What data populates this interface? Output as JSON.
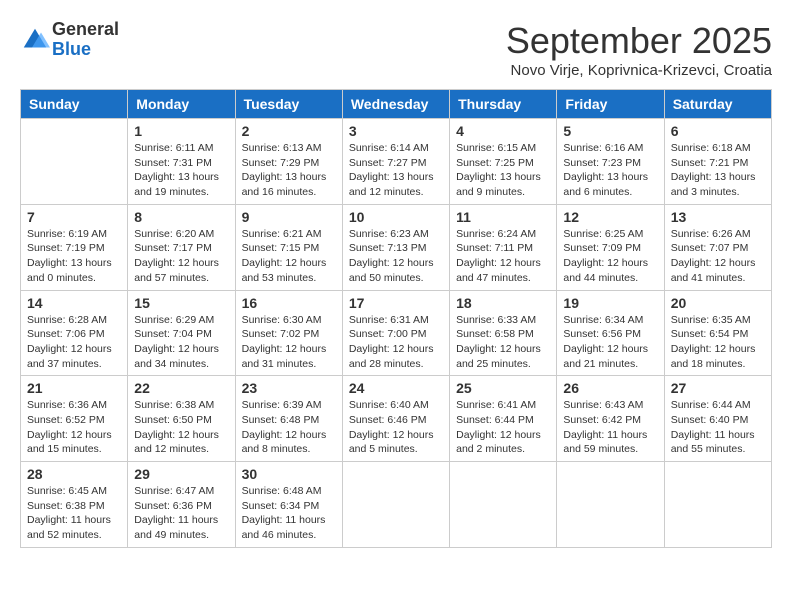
{
  "header": {
    "logo_general": "General",
    "logo_blue": "Blue",
    "month_title": "September 2025",
    "subtitle": "Novo Virje, Koprivnica-Krizevci, Croatia"
  },
  "days_of_week": [
    "Sunday",
    "Monday",
    "Tuesday",
    "Wednesday",
    "Thursday",
    "Friday",
    "Saturday"
  ],
  "weeks": [
    [
      {
        "day": "",
        "info": ""
      },
      {
        "day": "1",
        "info": "Sunrise: 6:11 AM\nSunset: 7:31 PM\nDaylight: 13 hours\nand 19 minutes."
      },
      {
        "day": "2",
        "info": "Sunrise: 6:13 AM\nSunset: 7:29 PM\nDaylight: 13 hours\nand 16 minutes."
      },
      {
        "day": "3",
        "info": "Sunrise: 6:14 AM\nSunset: 7:27 PM\nDaylight: 13 hours\nand 12 minutes."
      },
      {
        "day": "4",
        "info": "Sunrise: 6:15 AM\nSunset: 7:25 PM\nDaylight: 13 hours\nand 9 minutes."
      },
      {
        "day": "5",
        "info": "Sunrise: 6:16 AM\nSunset: 7:23 PM\nDaylight: 13 hours\nand 6 minutes."
      },
      {
        "day": "6",
        "info": "Sunrise: 6:18 AM\nSunset: 7:21 PM\nDaylight: 13 hours\nand 3 minutes."
      }
    ],
    [
      {
        "day": "7",
        "info": "Sunrise: 6:19 AM\nSunset: 7:19 PM\nDaylight: 13 hours\nand 0 minutes."
      },
      {
        "day": "8",
        "info": "Sunrise: 6:20 AM\nSunset: 7:17 PM\nDaylight: 12 hours\nand 57 minutes."
      },
      {
        "day": "9",
        "info": "Sunrise: 6:21 AM\nSunset: 7:15 PM\nDaylight: 12 hours\nand 53 minutes."
      },
      {
        "day": "10",
        "info": "Sunrise: 6:23 AM\nSunset: 7:13 PM\nDaylight: 12 hours\nand 50 minutes."
      },
      {
        "day": "11",
        "info": "Sunrise: 6:24 AM\nSunset: 7:11 PM\nDaylight: 12 hours\nand 47 minutes."
      },
      {
        "day": "12",
        "info": "Sunrise: 6:25 AM\nSunset: 7:09 PM\nDaylight: 12 hours\nand 44 minutes."
      },
      {
        "day": "13",
        "info": "Sunrise: 6:26 AM\nSunset: 7:07 PM\nDaylight: 12 hours\nand 41 minutes."
      }
    ],
    [
      {
        "day": "14",
        "info": "Sunrise: 6:28 AM\nSunset: 7:06 PM\nDaylight: 12 hours\nand 37 minutes."
      },
      {
        "day": "15",
        "info": "Sunrise: 6:29 AM\nSunset: 7:04 PM\nDaylight: 12 hours\nand 34 minutes."
      },
      {
        "day": "16",
        "info": "Sunrise: 6:30 AM\nSunset: 7:02 PM\nDaylight: 12 hours\nand 31 minutes."
      },
      {
        "day": "17",
        "info": "Sunrise: 6:31 AM\nSunset: 7:00 PM\nDaylight: 12 hours\nand 28 minutes."
      },
      {
        "day": "18",
        "info": "Sunrise: 6:33 AM\nSunset: 6:58 PM\nDaylight: 12 hours\nand 25 minutes."
      },
      {
        "day": "19",
        "info": "Sunrise: 6:34 AM\nSunset: 6:56 PM\nDaylight: 12 hours\nand 21 minutes."
      },
      {
        "day": "20",
        "info": "Sunrise: 6:35 AM\nSunset: 6:54 PM\nDaylight: 12 hours\nand 18 minutes."
      }
    ],
    [
      {
        "day": "21",
        "info": "Sunrise: 6:36 AM\nSunset: 6:52 PM\nDaylight: 12 hours\nand 15 minutes."
      },
      {
        "day": "22",
        "info": "Sunrise: 6:38 AM\nSunset: 6:50 PM\nDaylight: 12 hours\nand 12 minutes."
      },
      {
        "day": "23",
        "info": "Sunrise: 6:39 AM\nSunset: 6:48 PM\nDaylight: 12 hours\nand 8 minutes."
      },
      {
        "day": "24",
        "info": "Sunrise: 6:40 AM\nSunset: 6:46 PM\nDaylight: 12 hours\nand 5 minutes."
      },
      {
        "day": "25",
        "info": "Sunrise: 6:41 AM\nSunset: 6:44 PM\nDaylight: 12 hours\nand 2 minutes."
      },
      {
        "day": "26",
        "info": "Sunrise: 6:43 AM\nSunset: 6:42 PM\nDaylight: 11 hours\nand 59 minutes."
      },
      {
        "day": "27",
        "info": "Sunrise: 6:44 AM\nSunset: 6:40 PM\nDaylight: 11 hours\nand 55 minutes."
      }
    ],
    [
      {
        "day": "28",
        "info": "Sunrise: 6:45 AM\nSunset: 6:38 PM\nDaylight: 11 hours\nand 52 minutes."
      },
      {
        "day": "29",
        "info": "Sunrise: 6:47 AM\nSunset: 6:36 PM\nDaylight: 11 hours\nand 49 minutes."
      },
      {
        "day": "30",
        "info": "Sunrise: 6:48 AM\nSunset: 6:34 PM\nDaylight: 11 hours\nand 46 minutes."
      },
      {
        "day": "",
        "info": ""
      },
      {
        "day": "",
        "info": ""
      },
      {
        "day": "",
        "info": ""
      },
      {
        "day": "",
        "info": ""
      }
    ]
  ]
}
